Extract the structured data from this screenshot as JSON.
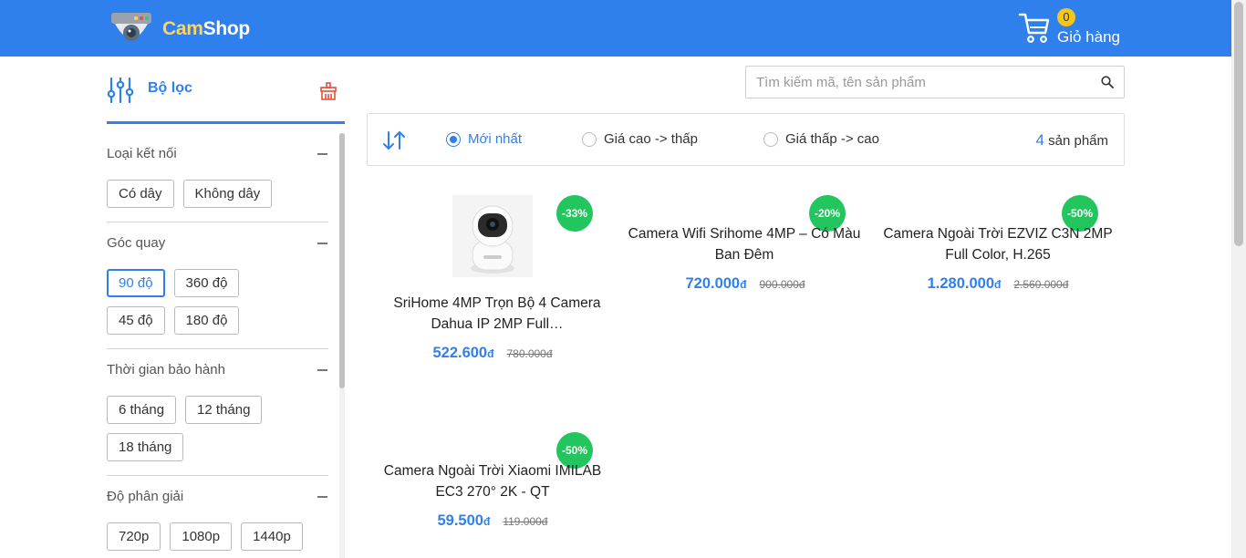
{
  "header": {
    "logo_cam": "Cam",
    "logo_shop": "Shop",
    "cart_count": "0",
    "cart_label": "Giỏ hàng"
  },
  "sidebar": {
    "title": "Bộ lọc",
    "groups": [
      {
        "title": "Loại kết nối",
        "options": [
          "Có dây",
          "Không dây"
        ],
        "selected": null
      },
      {
        "title": "Góc quay",
        "options": [
          "90 độ",
          "360 độ",
          "45 độ",
          "180 độ"
        ],
        "selected": "90 độ"
      },
      {
        "title": "Thời gian bảo hành",
        "options": [
          "6 tháng",
          "12 tháng",
          "18 tháng"
        ],
        "selected": null
      },
      {
        "title": "Độ phân giải",
        "options": [
          "720p",
          "1080p",
          "1440p"
        ],
        "selected": null
      }
    ]
  },
  "search": {
    "placeholder": "Tìm kiếm mã, tên sản phẩm"
  },
  "sort": {
    "options": [
      "Mới nhất",
      "Giá cao -> thấp",
      "Giá thấp -> cao"
    ],
    "selected": "Mới nhất",
    "count_num": "4",
    "count_label": " sản phẩm"
  },
  "products": [
    {
      "name": "SriHome 4MP Trọn Bộ 4 Camera Dahua IP 2MP Full…",
      "price": "522.600",
      "currency": "đ",
      "old_price": "780.000đ",
      "discount": "-33%",
      "has_image": true
    },
    {
      "name": "Camera Wifi Srihome 4MP – Có Màu Ban Đêm",
      "price": "720.000",
      "currency": "đ",
      "old_price": "900.000đ",
      "discount": "-20%",
      "has_image": false
    },
    {
      "name": "Camera Ngoài Trời EZVIZ C3N 2MP Full Color, H.265",
      "price": "1.280.000",
      "currency": "đ",
      "old_price": "2.560.000đ",
      "discount": "-50%",
      "has_image": false
    },
    {
      "name": "Camera Ngoài Trời Xiaomi IMILAB EC3 270° 2K - QT",
      "price": "59.500",
      "currency": "đ",
      "old_price": "119.000đ",
      "discount": "-50%",
      "has_image": false
    }
  ],
  "colors": {
    "brand_blue": "#2f80ed",
    "logo_yellow": "#ffd45c",
    "discount_green": "#22c55e",
    "badge_yellow": "#f5c518"
  }
}
